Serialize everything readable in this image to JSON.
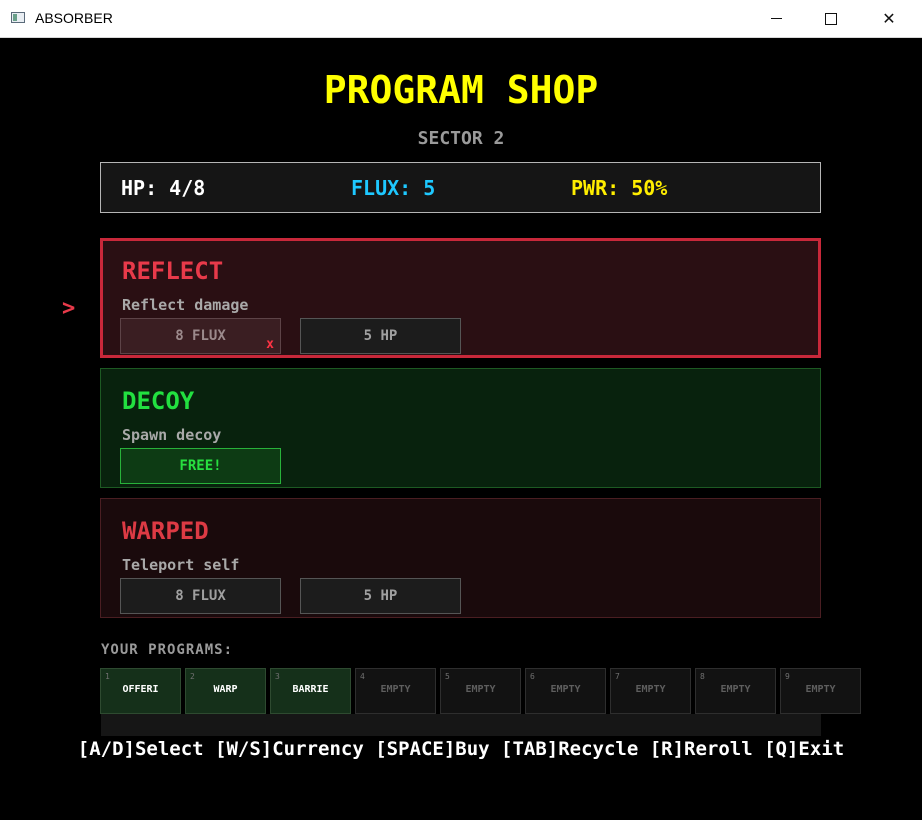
{
  "window": {
    "title": "ABSORBER",
    "minimize_label": "",
    "maximize_label": "",
    "close_label": "✕"
  },
  "shop": {
    "title": "PROGRAM SHOP",
    "sector": "SECTOR 2"
  },
  "stats": {
    "hp": "HP: 4/8",
    "flux": "FLUX: 5",
    "pwr": "PWR: 50%"
  },
  "selector_glyph": ">",
  "programs": [
    {
      "name": "REFLECT",
      "description": "Reflect damage",
      "price_flux": "8 FLUX",
      "price_hp": "5 HP",
      "unaffordable_mark": "x",
      "selected": true
    },
    {
      "name": "DECOY",
      "description": "Spawn decoy",
      "price_free": "FREE!"
    },
    {
      "name": "WARPED",
      "description": "Teleport self",
      "price_flux": "8 FLUX",
      "price_hp": "5 HP"
    }
  ],
  "your_programs": {
    "label": "YOUR PROGRAMS:",
    "slots": [
      {
        "num": "1",
        "label": "OFFERI"
      },
      {
        "num": "2",
        "label": "WARP"
      },
      {
        "num": "3",
        "label": "BARRIE"
      },
      {
        "num": "4",
        "label": "EMPTY"
      },
      {
        "num": "5",
        "label": "EMPTY"
      },
      {
        "num": "6",
        "label": "EMPTY"
      },
      {
        "num": "7",
        "label": "EMPTY"
      },
      {
        "num": "8",
        "label": "EMPTY"
      },
      {
        "num": "9",
        "label": "EMPTY"
      }
    ]
  },
  "help_text": "[A/D]Select [W/S]Currency [SPACE]Buy [TAB]Recycle [R]Reroll [Q]Exit",
  "colors": {
    "title": "#ffff00",
    "flux": "#1ec8ff",
    "pwr": "#ffee00",
    "selected_border": "#c8283a",
    "free": "#28e040"
  }
}
